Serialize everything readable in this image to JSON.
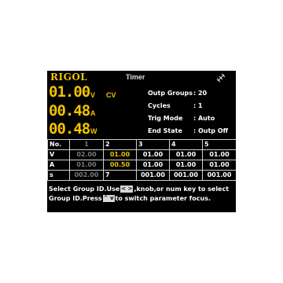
{
  "header": {
    "brand": "RIGOL",
    "title": "Timer",
    "status_icon": "usb-disconnected-icon"
  },
  "readouts": {
    "voltage": {
      "value": "01.00",
      "unit": "V"
    },
    "current": {
      "value": "00.48",
      "unit": "A"
    },
    "power": {
      "value": "00.48",
      "unit": "W"
    },
    "mode": "CV"
  },
  "info": [
    {
      "label": "Outp Groups",
      "value": ": 20"
    },
    {
      "label": "Cycles",
      "value": ": 1"
    },
    {
      "label": "Trig Mode",
      "value": ": Auto"
    },
    {
      "label": "End State",
      "value": ": Outp Off"
    }
  ],
  "table": {
    "header": [
      "No.",
      "1",
      "2",
      "3",
      "4",
      "5"
    ],
    "rows": [
      {
        "label": "V",
        "cells": [
          "02.00",
          "01.00",
          "01.00",
          "01.00",
          "01.00"
        ]
      },
      {
        "label": "A",
        "cells": [
          "01.00",
          "00.50",
          "01.00",
          "01.00",
          "01.00"
        ]
      },
      {
        "label": "s",
        "cells": [
          "002.00",
          "7",
          "001.00",
          "001.00",
          "001.00"
        ]
      }
    ]
  },
  "help": {
    "part1": "Select Group ID.Use",
    "key_lr": "< >",
    "part2": ",knob,or num key to select Group ID.Press",
    "key_ud": "^ v",
    "part3": "to switch parameter focus."
  },
  "colors": {
    "accent": "#f2c300",
    "background": "#000000",
    "text": "#ffffff",
    "dim": "#7a7a7a"
  }
}
